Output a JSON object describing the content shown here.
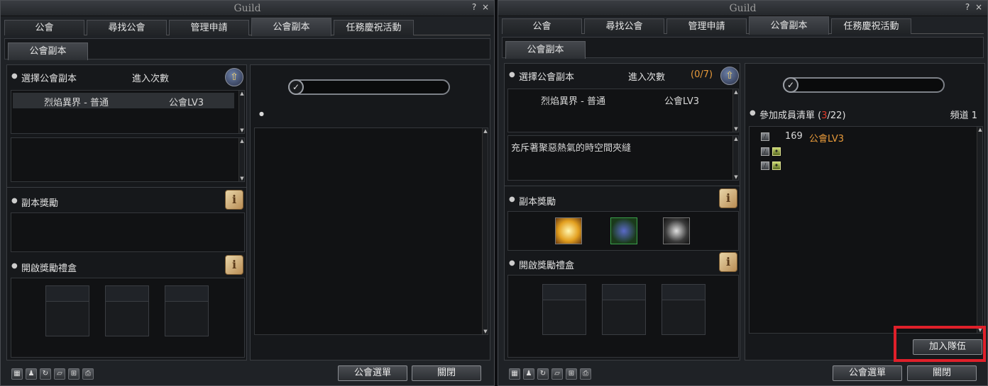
{
  "left": {
    "window_title": "Guild",
    "help_label": "?",
    "close_label": "×",
    "tabs": [
      "公會",
      "尋找公會",
      "管理申請",
      "公會副本",
      "任務慶祝活動"
    ],
    "subtab": "公會副本",
    "select_dungeon_label": "選擇公會副本",
    "entry_count_label": "進入次數",
    "dungeon_row": {
      "name": "烈焰異界 - 普通",
      "level": "公會LV3"
    },
    "reward_label": "副本獎勵",
    "gift_label": "開啟獎勵禮盒",
    "guild_menu_button": "公會選單",
    "close_button": "關閉"
  },
  "right": {
    "window_title": "Guild",
    "help_label": "?",
    "close_label": "×",
    "tabs": [
      "公會",
      "尋找公會",
      "管理申請",
      "公會副本",
      "任務慶祝活動"
    ],
    "subtab": "公會副本",
    "select_dungeon_label": "選擇公會副本",
    "entry_count_label": "進入次數",
    "entry_count_open": "(",
    "entry_count_value": "0/7",
    "entry_count_close": ")",
    "dungeon_row": {
      "name": "烈焰異界 - 普通",
      "level": "公會LV3"
    },
    "dungeon_desc": "充斥著聚惡熱氣的時空間夾縫",
    "reward_label": "副本獎勵",
    "gift_label": "開啟獎勵禮盒",
    "members_label": "參加成員清單",
    "members_open": "(",
    "members_current": "3",
    "members_total": "/22)",
    "channel_label": "頻道 1",
    "member_rows": [
      {
        "level": "169",
        "guild": "公會LV3"
      }
    ],
    "join_party_button": "加入隊伍",
    "guild_menu_button": "公會選單",
    "close_button": "關閉"
  },
  "colors": {
    "accent_orange": "#e89a3a",
    "count_red": "#e03a2a",
    "highlight": "#e0202a"
  },
  "icons": {
    "bottom_bar": [
      "guild-icon",
      "member-icon",
      "refresh-icon",
      "card-icon",
      "cart-icon",
      "page-icon"
    ]
  }
}
